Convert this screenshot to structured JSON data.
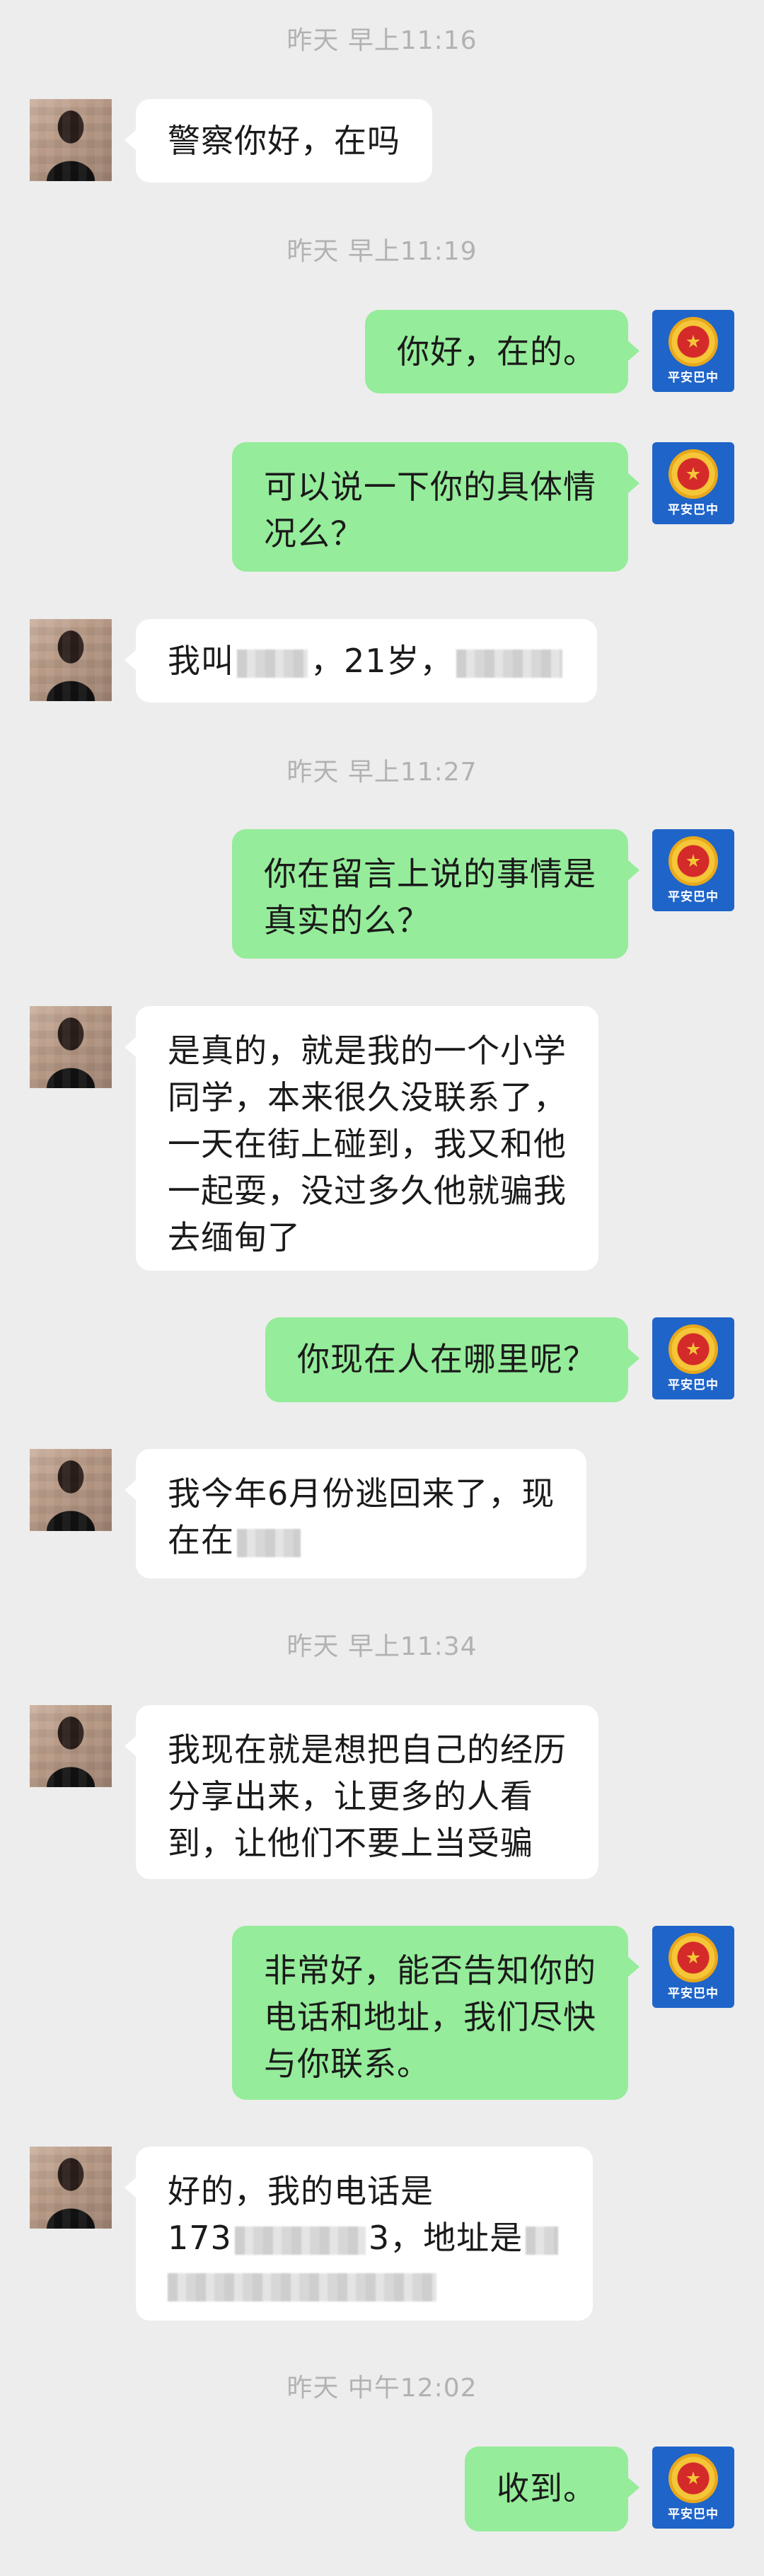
{
  "outgoing_avatar_label": "平安巴中",
  "timestamps": [
    "昨天 早上11:16",
    "昨天 早上11:19",
    "昨天 早上11:27",
    "昨天 早上11:34",
    "昨天 中午12:02"
  ],
  "messages": [
    {
      "from": "user",
      "lines": [
        "警察你好，在吗"
      ]
    },
    {
      "from": "police",
      "lines": [
        "你好，在的。"
      ]
    },
    {
      "from": "police",
      "lines": [
        "可以说一下你的具体情",
        "况么？"
      ]
    },
    {
      "from": "user",
      "lines": [
        "我叫",
        "，21岁，"
      ]
    },
    {
      "from": "police",
      "lines": [
        "你在留言上说的事情是",
        "真实的么？"
      ]
    },
    {
      "from": "user",
      "lines": [
        "是真的，就是我的一个小学",
        "同学，本来很久没联系了，",
        "一天在街上碰到，我又和他",
        "一起耍，没过多久他就骗我",
        "去缅甸了"
      ]
    },
    {
      "from": "police",
      "lines": [
        "你现在人在哪里呢？"
      ]
    },
    {
      "from": "user",
      "lines": [
        "我今年6月份逃回来了，现",
        "在在"
      ]
    },
    {
      "from": "user",
      "lines": [
        "我现在就是想把自己的经历",
        "分享出来，让更多的人看",
        "到，让他们不要上当受骗"
      ]
    },
    {
      "from": "police",
      "lines": [
        "非常好，能否告知你的",
        "电话和地址，我们尽快",
        "与你联系。"
      ]
    },
    {
      "from": "user",
      "lines": [
        "好的，我的电话是",
        "173",
        "3，地址是"
      ]
    },
    {
      "from": "police",
      "lines": [
        "收到。"
      ]
    }
  ]
}
